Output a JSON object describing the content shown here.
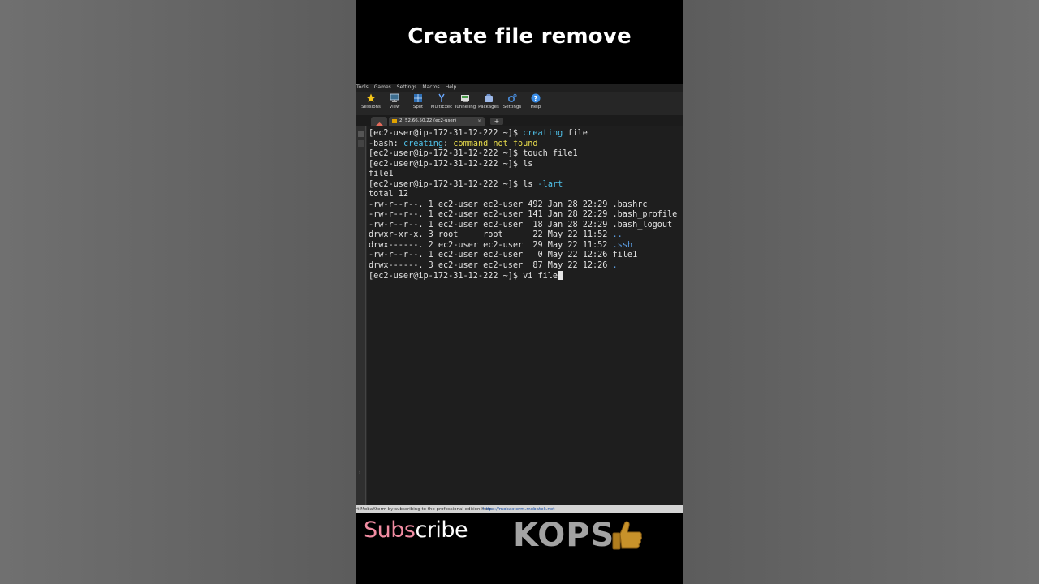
{
  "headline": "Create file remove",
  "menu": [
    "Tools",
    "Games",
    "Settings",
    "Macros",
    "Help"
  ],
  "toolbar": [
    {
      "label": "Sessions",
      "icon": "star-icon",
      "color": "#f5c518"
    },
    {
      "label": "View",
      "icon": "monitor-icon",
      "color": "#7fb3d5"
    },
    {
      "label": "Split",
      "icon": "grid-icon",
      "color": "#5aa9e6"
    },
    {
      "label": "MultiExec",
      "icon": "fork-icon",
      "color": "#6aa8ff"
    },
    {
      "label": "Tunneling",
      "icon": "tunnel-icon",
      "color": "#5fbf5f"
    },
    {
      "label": "Packages",
      "icon": "package-icon",
      "color": "#9db8e8"
    },
    {
      "label": "Settings",
      "icon": "gear-icon",
      "color": "#4a8fe0"
    },
    {
      "label": "Help",
      "icon": "help-icon",
      "color": "#3b8ee8"
    }
  ],
  "tab": {
    "label": "2. 52.66.50.22 (ec2-user)",
    "close": "×",
    "add": "+"
  },
  "terminal": {
    "prompt": "[ec2-user@ip-172-31-12-222 ~]$ ",
    "lines": [
      {
        "segments": [
          {
            "t": "[ec2-user@ip-172-31-12-222 ~]$ "
          },
          {
            "t": "creating",
            "c": "cyan"
          },
          {
            "t": " file"
          }
        ]
      },
      {
        "segments": [
          {
            "t": "-bash: "
          },
          {
            "t": "creating",
            "c": "cyan"
          },
          {
            "t": ": "
          },
          {
            "t": "command not found",
            "c": "yellow"
          }
        ]
      },
      {
        "segments": [
          {
            "t": "[ec2-user@ip-172-31-12-222 ~]$ touch file1"
          }
        ]
      },
      {
        "segments": [
          {
            "t": "[ec2-user@ip-172-31-12-222 ~]$ ls"
          }
        ]
      },
      {
        "segments": [
          {
            "t": "file1"
          }
        ]
      },
      {
        "segments": [
          {
            "t": "[ec2-user@ip-172-31-12-222 ~]$ ls "
          },
          {
            "t": "-lart",
            "c": "cyan"
          }
        ]
      },
      {
        "segments": [
          {
            "t": "total 12"
          }
        ]
      },
      {
        "segments": [
          {
            "t": "-rw-r--r--. 1 ec2-user ec2-user 492 Jan 28 22:29 .bashrc"
          }
        ]
      },
      {
        "segments": [
          {
            "t": "-rw-r--r--. 1 ec2-user ec2-user 141 Jan 28 22:29 .bash_profile"
          }
        ]
      },
      {
        "segments": [
          {
            "t": "-rw-r--r--. 1 ec2-user ec2-user  18 Jan 28 22:29 .bash_logout"
          }
        ]
      },
      {
        "segments": [
          {
            "t": "drwxr-xr-x. 3 root     root      22 May 22 11:52 "
          },
          {
            "t": "..",
            "c": "blue"
          }
        ]
      },
      {
        "segments": [
          {
            "t": "drwx------. 2 ec2-user ec2-user  29 May 22 11:52 "
          },
          {
            "t": ".ssh",
            "c": "blue"
          }
        ]
      },
      {
        "segments": [
          {
            "t": "-rw-r--r--. 1 ec2-user ec2-user   0 May 22 12:26 file1"
          }
        ]
      },
      {
        "segments": [
          {
            "t": "drwx------. 3 ec2-user ec2-user  87 May 22 12:26 "
          },
          {
            "t": ".",
            "c": "blue"
          }
        ]
      },
      {
        "segments": [
          {
            "t": "[ec2-user@ip-172-31-12-222 ~]$ vi file"
          }
        ],
        "cursor": true
      }
    ]
  },
  "statusbar": {
    "message": "rt MobaXterm by subscribing to the professional edition here:",
    "link": "https://mobaxterm.mobatek.net"
  },
  "branding": {
    "subscribe_pink": "Subs",
    "subscribe_white": "cribe",
    "kops": "KOPS"
  },
  "colors": {
    "subscribe_pink": "#f18ca2",
    "kops_gray": "#a3a3a3",
    "terminal_bg": "#1e1e1e",
    "thumb_gold": "#c8922a"
  }
}
